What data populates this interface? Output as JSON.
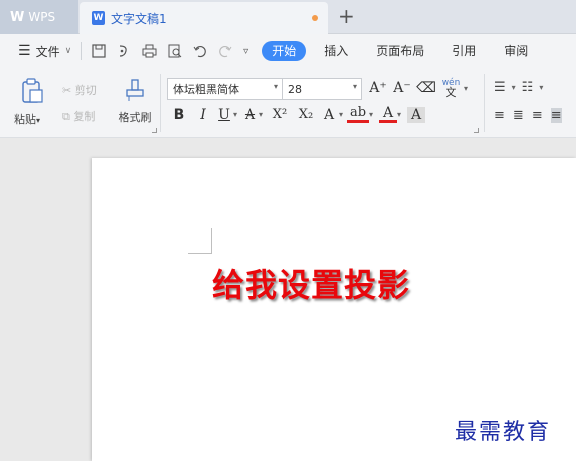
{
  "app": {
    "name": "WPS"
  },
  "document_tab": {
    "title": "文字文稿1",
    "modified_color": "#f39b4b"
  },
  "new_tab_icon": "plus-icon",
  "menu": {
    "file_label": "文件",
    "tabs": [
      {
        "label": "开始",
        "active": true
      },
      {
        "label": "插入",
        "active": false
      },
      {
        "label": "页面布局",
        "active": false
      },
      {
        "label": "引用",
        "active": false
      },
      {
        "label": "审阅",
        "active": false
      }
    ]
  },
  "ribbon": {
    "paste_label": "粘贴",
    "cut_label": "剪切",
    "copy_label": "复制",
    "format_painter_label": "格式刷",
    "font_name": "体坛粗黑简体",
    "font_size": "28",
    "bold": "B",
    "italic": "I",
    "underline": "U",
    "strikethrough": "A",
    "superscript": "X²",
    "subscript": "X₂",
    "grow_font": "A⁺",
    "shrink_font": "A⁻",
    "phonetic": "wén",
    "phonetic_sub": "文",
    "text_effect": "A",
    "highlight": "ab",
    "font_color": "A",
    "char_shading": "A",
    "accent_color": "#3d8af7",
    "font_color_value": "#e21f1f"
  },
  "document": {
    "body_text": "给我设置投影",
    "text_color": "#e8080c"
  },
  "watermark": {
    "text": "最需教育",
    "color": "#1f2ea6"
  }
}
